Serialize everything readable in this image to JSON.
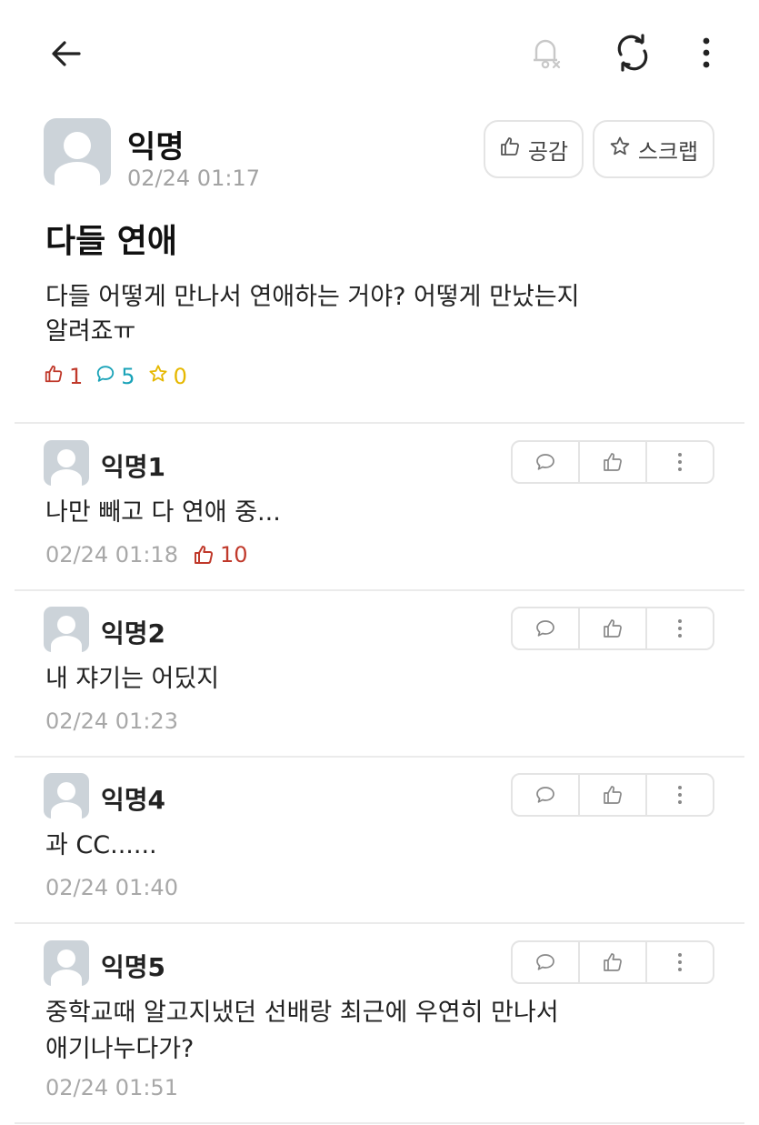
{
  "topbar": {
    "icons": [
      "back-arrow-icon",
      "bell-off-icon",
      "refresh-icon",
      "more-vertical-icon"
    ]
  },
  "post": {
    "author": "익명",
    "time": "02/24 01:17",
    "like_button_label": "공감",
    "scrap_button_label": "스크랩",
    "title": "다들 연애",
    "body_line1": "다들 어떻게 만나서 연애하는 거야? 어떻게 만났는지",
    "body_line2": "알려죠ㅠ",
    "likes": "1",
    "comments": "5",
    "scraps": "0"
  },
  "colors": {
    "like": "#c0392b",
    "comment": "#1aa3b8",
    "scrap": "#e6b800",
    "muted": "#a3a3a3",
    "avatar": "#ccd3d9"
  },
  "comments": [
    {
      "author": "익명1",
      "text_line1": "나만 빼고 다 연애 중...",
      "text_line2": "",
      "time": "02/24 01:18",
      "likes": "10"
    },
    {
      "author": "익명2",
      "text_line1": "내 쟈기는 어딨지",
      "text_line2": "",
      "time": "02/24 01:23",
      "likes": ""
    },
    {
      "author": "익명4",
      "text_line1": "과 CC......",
      "text_line2": "",
      "time": "02/24 01:40",
      "likes": ""
    },
    {
      "author": "익명5",
      "text_line1": "중학교때 알고지냈던 선배랑 최근에 우연히 만나서",
      "text_line2": "애기나누다가?",
      "time": "02/24 01:51",
      "likes": ""
    }
  ]
}
